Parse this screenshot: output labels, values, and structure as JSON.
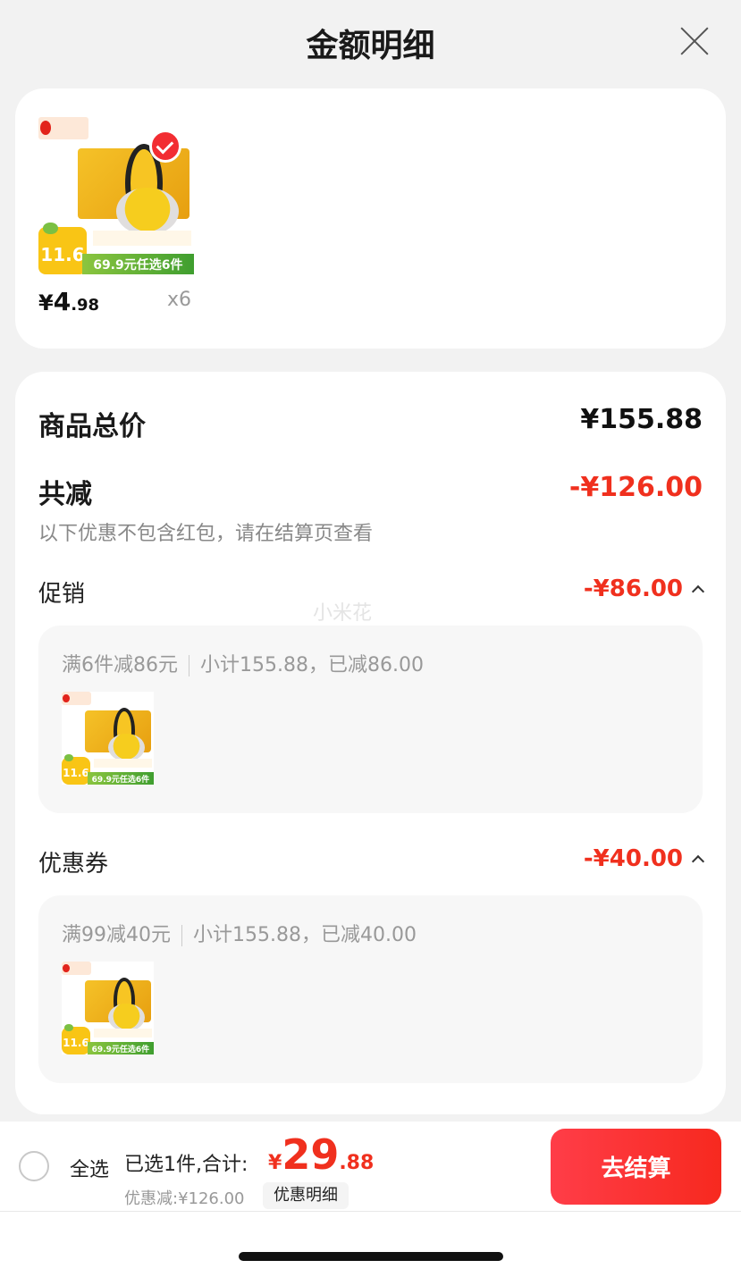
{
  "header": {
    "title": "金额明细"
  },
  "product": {
    "price_currency": "¥",
    "price_int": "4",
    "price_dec": ".98",
    "qty": "x6",
    "thumb": {
      "badge": "11.6",
      "strip": "69.9元任选6件"
    }
  },
  "summary": {
    "total_label": "商品总价",
    "total_value": "¥155.88",
    "reduce_label": "共减",
    "reduce_value": "-¥126.00",
    "hint": "以下优惠不包含红包，请在结算页查看",
    "promo": {
      "label": "促销",
      "value": "-¥86.00",
      "rule": "满6件减86元",
      "detail": "小计155.88，已减86.00"
    },
    "coupon": {
      "label": "优惠券",
      "value": "-¥40.00",
      "rule": "满99减40元",
      "detail": "小计155.88，已减40.00"
    }
  },
  "watermark": "小米花",
  "footer": {
    "select_all": "全选",
    "selected_text": "已选1件,合计:",
    "total_currency": "¥",
    "total_int": "29",
    "total_dec": ".88",
    "discount": "优惠减:¥126.00",
    "detail_button": "优惠明细",
    "checkout_button": "去结算"
  },
  "colors": {
    "accent": "#f0301e",
    "button": "#f7291f"
  }
}
